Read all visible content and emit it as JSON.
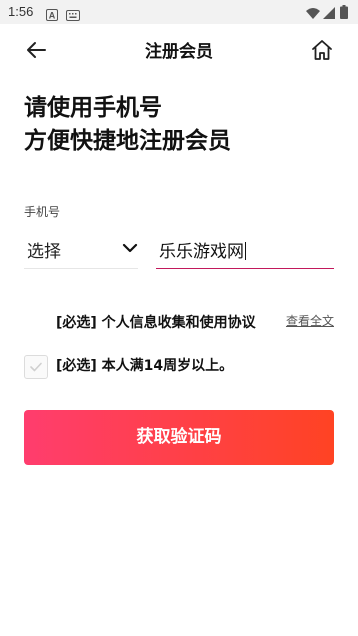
{
  "status_bar": {
    "time": "1:56",
    "icons": [
      "notification-a-icon",
      "keyboard-icon",
      "wifi-icon",
      "signal-icon",
      "battery-icon"
    ]
  },
  "nav": {
    "title": "注册会员",
    "back_icon": "arrow-left-icon",
    "home_icon": "home-icon"
  },
  "headline": {
    "line1": "请使用手机号",
    "line2": "方便快捷地注册会员"
  },
  "form": {
    "phone_label": "手机号",
    "country_select": "选择",
    "phone_value": "乐乐游戏网"
  },
  "agreements": {
    "privacy_text": "[必选] 个人信息收集和使用协议",
    "view_full": "查看全文",
    "age_text": "[必选] 本人满14周岁以上。",
    "age_checked": false
  },
  "cta": {
    "label": "获取验证码"
  },
  "colors": {
    "cta_gradient_start": "#ff3d6e",
    "cta_gradient_end": "#ff4323",
    "input_underline": "#c2185b"
  }
}
